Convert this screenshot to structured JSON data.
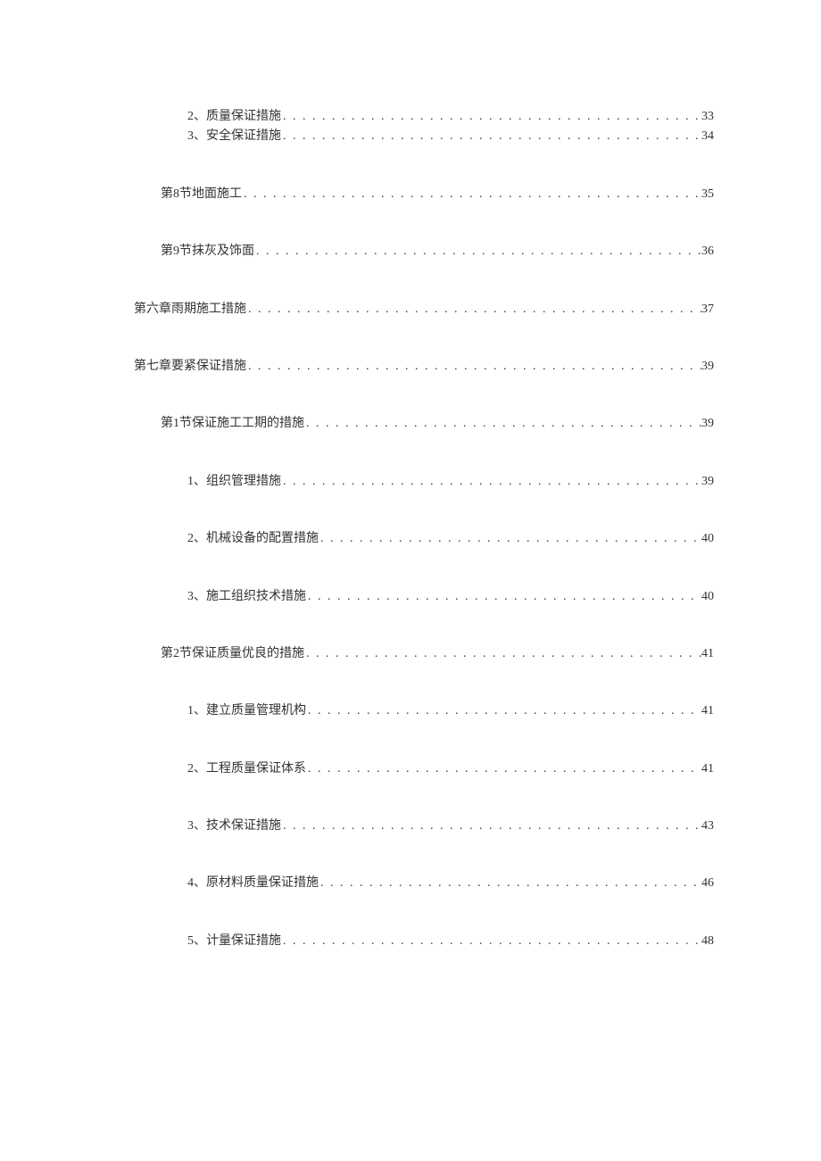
{
  "toc": [
    {
      "level": 2,
      "label": "2、质量保证措施",
      "page": "33",
      "compact": true
    },
    {
      "level": 2,
      "label": "3、安全保证措施",
      "page": "34",
      "compact": true,
      "afterGap": true
    },
    {
      "level": 1,
      "label": "第8节地面施工",
      "page": "35",
      "afterGap": true
    },
    {
      "level": 1,
      "label": "第9节抹灰及饰面",
      "page": "36",
      "afterGap": true
    },
    {
      "level": 0,
      "label": "第六章雨期施工措施",
      "page": "37",
      "afterGap": true
    },
    {
      "level": 0,
      "label": "第七章要紧保证措施",
      "page": "39",
      "afterGap": true
    },
    {
      "level": 1,
      "label": "第1节保证施工工期的措施",
      "page": "39",
      "afterGap": true
    },
    {
      "level": 2,
      "label": "1、组织管理措施",
      "page": "39",
      "afterGap": true
    },
    {
      "level": 2,
      "label": "2、机械设备的配置措施",
      "page": "40",
      "afterGap": true
    },
    {
      "level": 2,
      "label": "3、施工组织技术措施",
      "page": "40",
      "afterGap": true
    },
    {
      "level": 1,
      "label": "第2节保证质量优良的措施",
      "page": "41",
      "afterGap": true
    },
    {
      "level": 2,
      "label": "1、建立质量管理机构",
      "page": "41",
      "afterGap": true
    },
    {
      "level": 2,
      "label": "2、工程质量保证体系",
      "page": "41",
      "afterGap": true
    },
    {
      "level": 2,
      "label": "3、技术保证措施",
      "page": "43",
      "afterGap": true
    },
    {
      "level": 2,
      "label": "4、原材料质量保证措施",
      "page": "46",
      "afterGap": true
    },
    {
      "level": 2,
      "label": "5、计量保证措施",
      "page": "48",
      "afterGap": true
    }
  ]
}
